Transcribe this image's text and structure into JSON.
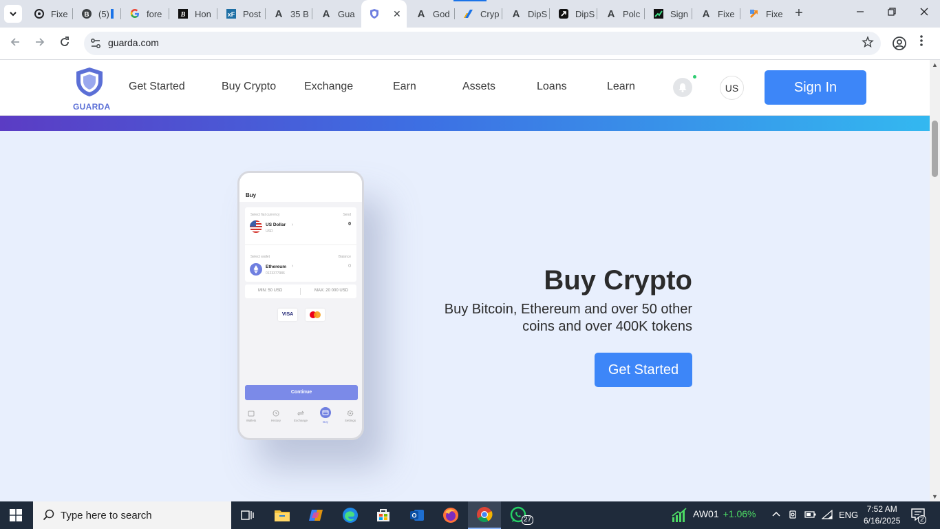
{
  "browser": {
    "tabs": [
      {
        "title": "Fixe",
        "icon": "openai-icon"
      },
      {
        "title": "(5)",
        "icon": "b-icon"
      },
      {
        "title": "fore",
        "icon": "google-icon"
      },
      {
        "title": "Hon",
        "icon": "b-square-icon"
      },
      {
        "title": "Post",
        "icon": "xf-icon"
      },
      {
        "title": "35 B",
        "icon": "a-icon"
      },
      {
        "title": "Gua",
        "icon": "a-icon"
      },
      {
        "title": "",
        "icon": "guarda-shield-icon",
        "active": true
      },
      {
        "title": "God",
        "icon": "a-icon"
      },
      {
        "title": "Cryp",
        "icon": "slash-icon"
      },
      {
        "title": "DipS",
        "icon": "a-icon"
      },
      {
        "title": "DipS",
        "icon": "d-icon"
      },
      {
        "title": "Polc",
        "icon": "a-icon"
      },
      {
        "title": "Sign",
        "icon": "chart-icon"
      },
      {
        "title": "Fixe",
        "icon": "a-icon"
      },
      {
        "title": "Fixe",
        "icon": "arrow-icon"
      }
    ],
    "url": "guarda.com"
  },
  "site": {
    "logo_text": "GUARDA",
    "nav": [
      "Get Started",
      "Buy Crypto",
      "Exchange",
      "Earn",
      "Assets",
      "Loans",
      "Learn"
    ],
    "lang": "US",
    "signin": "Sign In"
  },
  "phone": {
    "header": "Buy",
    "fiat_label": "Select fiat currency",
    "send_label": "Send",
    "fiat_name": "US Dollar",
    "fiat_code": "USD",
    "fiat_value": "0",
    "wallet_label": "Select wallet",
    "balance_label": "Balance",
    "wallet_name": "Ethereum",
    "wallet_addr": "0123377986",
    "wallet_value": "0",
    "min": "MIN: 50 USD",
    "max": "MAX: 20 000 USD",
    "visa": "VISA",
    "continue": "Continue",
    "nav": [
      "Wallets",
      "History",
      "Exchange",
      "Buy",
      "Settings"
    ]
  },
  "hero": {
    "title": "Buy Crypto",
    "subtitle": "Buy Bitcoin, Ethereum and over 50 other coins and over 400K tokens",
    "cta": "Get Started"
  },
  "taskbar": {
    "search_placeholder": "Type here to search",
    "whatsapp_badge": "27",
    "ticker_name": "AW01",
    "ticker_change": "+1.06%",
    "lang": "ENG",
    "time": "7:52 AM",
    "date": "6/16/2025",
    "notifications": "2"
  }
}
